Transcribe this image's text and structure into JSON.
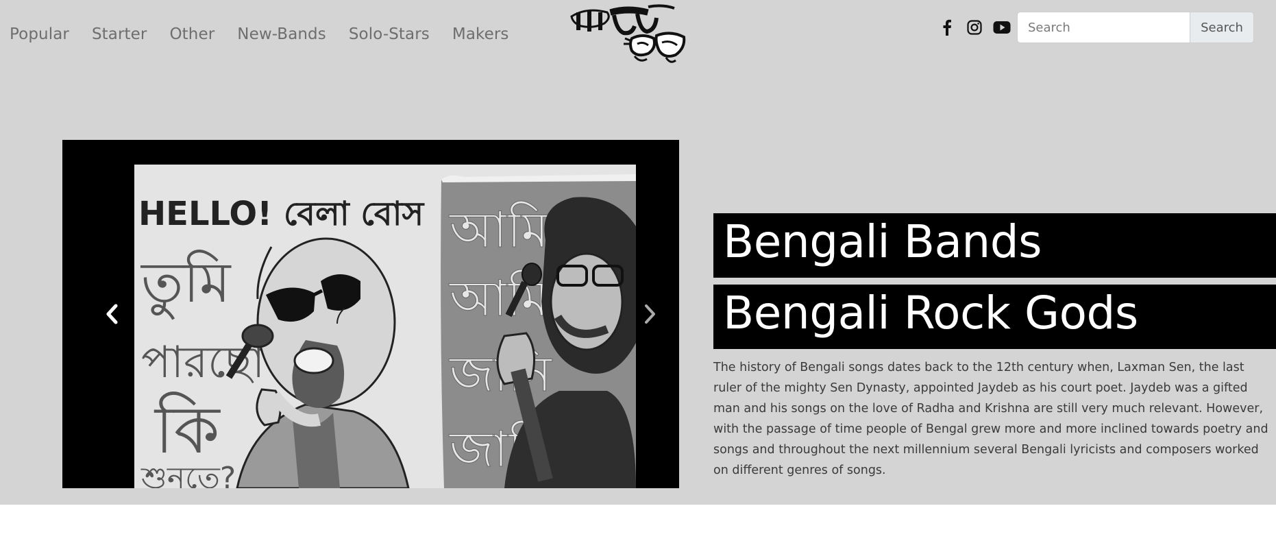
{
  "nav": {
    "links": [
      "Popular",
      "Starter",
      "Other",
      "New-Bands",
      "Solo-Stars",
      "Makers"
    ],
    "logo_alt": "বাংলা রক",
    "socials": [
      "facebook-icon",
      "instagram-icon",
      "youtube-icon"
    ]
  },
  "search": {
    "placeholder": "Search",
    "button_label": "Search"
  },
  "carousel": {
    "prev_icon": "chevron-left-icon",
    "next_icon": "chevron-right-icon",
    "slide_texts": {
      "left_top": "HELLO! বেলা বোস",
      "left_col": [
        "তুমি",
        "পারছো",
        "কি",
        "শুনতে?"
      ],
      "right_col": [
        "আমি",
        "আমি",
        "জানি",
        "জানি"
      ]
    }
  },
  "hero": {
    "title_1": "Bengali Bands",
    "title_2": "Bengali Rock Gods",
    "description": "The history of Bengali songs dates back to the 12th century when, Laxman Sen, the last ruler of the mighty Sen Dynasty, appointed Jaydeb as his court poet. Jaydeb was a gifted man and his songs on the love of Radha and Krishna are still very much relevant. However, with the passage of time people of Bengal grew more and more inclined towards poetry and songs and throughout the next millennium several Bengali lyricists and composers worked on different genres of songs."
  },
  "colors": {
    "hero_bg": "#d4d4d4",
    "title_bg": "#000000",
    "nav_link": "#6e6e6e"
  }
}
